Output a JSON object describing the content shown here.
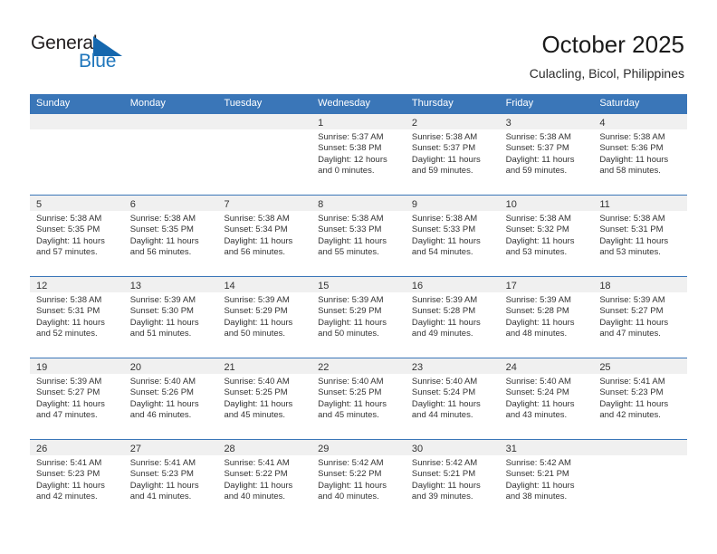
{
  "logo": {
    "word1": "General",
    "word2": "Blue",
    "triangle_color": "#1567ae",
    "blue_text_color": "#1f76bc"
  },
  "header": {
    "title": "October 2025",
    "subtitle": "Culacling, Bicol, Philippines"
  },
  "calendar": {
    "header_bg": "#3a76b8",
    "day_band_bg": "#f0f0f0",
    "weekdays": [
      "Sunday",
      "Monday",
      "Tuesday",
      "Wednesday",
      "Thursday",
      "Friday",
      "Saturday"
    ],
    "weeks": [
      [
        {
          "day": "",
          "sunrise": "",
          "sunset": "",
          "daylight1": "",
          "daylight2": ""
        },
        {
          "day": "",
          "sunrise": "",
          "sunset": "",
          "daylight1": "",
          "daylight2": ""
        },
        {
          "day": "",
          "sunrise": "",
          "sunset": "",
          "daylight1": "",
          "daylight2": ""
        },
        {
          "day": "1",
          "sunrise": "Sunrise: 5:37 AM",
          "sunset": "Sunset: 5:38 PM",
          "daylight1": "Daylight: 12 hours",
          "daylight2": "and 0 minutes."
        },
        {
          "day": "2",
          "sunrise": "Sunrise: 5:38 AM",
          "sunset": "Sunset: 5:37 PM",
          "daylight1": "Daylight: 11 hours",
          "daylight2": "and 59 minutes."
        },
        {
          "day": "3",
          "sunrise": "Sunrise: 5:38 AM",
          "sunset": "Sunset: 5:37 PM",
          "daylight1": "Daylight: 11 hours",
          "daylight2": "and 59 minutes."
        },
        {
          "day": "4",
          "sunrise": "Sunrise: 5:38 AM",
          "sunset": "Sunset: 5:36 PM",
          "daylight1": "Daylight: 11 hours",
          "daylight2": "and 58 minutes."
        }
      ],
      [
        {
          "day": "5",
          "sunrise": "Sunrise: 5:38 AM",
          "sunset": "Sunset: 5:35 PM",
          "daylight1": "Daylight: 11 hours",
          "daylight2": "and 57 minutes."
        },
        {
          "day": "6",
          "sunrise": "Sunrise: 5:38 AM",
          "sunset": "Sunset: 5:35 PM",
          "daylight1": "Daylight: 11 hours",
          "daylight2": "and 56 minutes."
        },
        {
          "day": "7",
          "sunrise": "Sunrise: 5:38 AM",
          "sunset": "Sunset: 5:34 PM",
          "daylight1": "Daylight: 11 hours",
          "daylight2": "and 56 minutes."
        },
        {
          "day": "8",
          "sunrise": "Sunrise: 5:38 AM",
          "sunset": "Sunset: 5:33 PM",
          "daylight1": "Daylight: 11 hours",
          "daylight2": "and 55 minutes."
        },
        {
          "day": "9",
          "sunrise": "Sunrise: 5:38 AM",
          "sunset": "Sunset: 5:33 PM",
          "daylight1": "Daylight: 11 hours",
          "daylight2": "and 54 minutes."
        },
        {
          "day": "10",
          "sunrise": "Sunrise: 5:38 AM",
          "sunset": "Sunset: 5:32 PM",
          "daylight1": "Daylight: 11 hours",
          "daylight2": "and 53 minutes."
        },
        {
          "day": "11",
          "sunrise": "Sunrise: 5:38 AM",
          "sunset": "Sunset: 5:31 PM",
          "daylight1": "Daylight: 11 hours",
          "daylight2": "and 53 minutes."
        }
      ],
      [
        {
          "day": "12",
          "sunrise": "Sunrise: 5:38 AM",
          "sunset": "Sunset: 5:31 PM",
          "daylight1": "Daylight: 11 hours",
          "daylight2": "and 52 minutes."
        },
        {
          "day": "13",
          "sunrise": "Sunrise: 5:39 AM",
          "sunset": "Sunset: 5:30 PM",
          "daylight1": "Daylight: 11 hours",
          "daylight2": "and 51 minutes."
        },
        {
          "day": "14",
          "sunrise": "Sunrise: 5:39 AM",
          "sunset": "Sunset: 5:29 PM",
          "daylight1": "Daylight: 11 hours",
          "daylight2": "and 50 minutes."
        },
        {
          "day": "15",
          "sunrise": "Sunrise: 5:39 AM",
          "sunset": "Sunset: 5:29 PM",
          "daylight1": "Daylight: 11 hours",
          "daylight2": "and 50 minutes."
        },
        {
          "day": "16",
          "sunrise": "Sunrise: 5:39 AM",
          "sunset": "Sunset: 5:28 PM",
          "daylight1": "Daylight: 11 hours",
          "daylight2": "and 49 minutes."
        },
        {
          "day": "17",
          "sunrise": "Sunrise: 5:39 AM",
          "sunset": "Sunset: 5:28 PM",
          "daylight1": "Daylight: 11 hours",
          "daylight2": "and 48 minutes."
        },
        {
          "day": "18",
          "sunrise": "Sunrise: 5:39 AM",
          "sunset": "Sunset: 5:27 PM",
          "daylight1": "Daylight: 11 hours",
          "daylight2": "and 47 minutes."
        }
      ],
      [
        {
          "day": "19",
          "sunrise": "Sunrise: 5:39 AM",
          "sunset": "Sunset: 5:27 PM",
          "daylight1": "Daylight: 11 hours",
          "daylight2": "and 47 minutes."
        },
        {
          "day": "20",
          "sunrise": "Sunrise: 5:40 AM",
          "sunset": "Sunset: 5:26 PM",
          "daylight1": "Daylight: 11 hours",
          "daylight2": "and 46 minutes."
        },
        {
          "day": "21",
          "sunrise": "Sunrise: 5:40 AM",
          "sunset": "Sunset: 5:25 PM",
          "daylight1": "Daylight: 11 hours",
          "daylight2": "and 45 minutes."
        },
        {
          "day": "22",
          "sunrise": "Sunrise: 5:40 AM",
          "sunset": "Sunset: 5:25 PM",
          "daylight1": "Daylight: 11 hours",
          "daylight2": "and 45 minutes."
        },
        {
          "day": "23",
          "sunrise": "Sunrise: 5:40 AM",
          "sunset": "Sunset: 5:24 PM",
          "daylight1": "Daylight: 11 hours",
          "daylight2": "and 44 minutes."
        },
        {
          "day": "24",
          "sunrise": "Sunrise: 5:40 AM",
          "sunset": "Sunset: 5:24 PM",
          "daylight1": "Daylight: 11 hours",
          "daylight2": "and 43 minutes."
        },
        {
          "day": "25",
          "sunrise": "Sunrise: 5:41 AM",
          "sunset": "Sunset: 5:23 PM",
          "daylight1": "Daylight: 11 hours",
          "daylight2": "and 42 minutes."
        }
      ],
      [
        {
          "day": "26",
          "sunrise": "Sunrise: 5:41 AM",
          "sunset": "Sunset: 5:23 PM",
          "daylight1": "Daylight: 11 hours",
          "daylight2": "and 42 minutes."
        },
        {
          "day": "27",
          "sunrise": "Sunrise: 5:41 AM",
          "sunset": "Sunset: 5:23 PM",
          "daylight1": "Daylight: 11 hours",
          "daylight2": "and 41 minutes."
        },
        {
          "day": "28",
          "sunrise": "Sunrise: 5:41 AM",
          "sunset": "Sunset: 5:22 PM",
          "daylight1": "Daylight: 11 hours",
          "daylight2": "and 40 minutes."
        },
        {
          "day": "29",
          "sunrise": "Sunrise: 5:42 AM",
          "sunset": "Sunset: 5:22 PM",
          "daylight1": "Daylight: 11 hours",
          "daylight2": "and 40 minutes."
        },
        {
          "day": "30",
          "sunrise": "Sunrise: 5:42 AM",
          "sunset": "Sunset: 5:21 PM",
          "daylight1": "Daylight: 11 hours",
          "daylight2": "and 39 minutes."
        },
        {
          "day": "31",
          "sunrise": "Sunrise: 5:42 AM",
          "sunset": "Sunset: 5:21 PM",
          "daylight1": "Daylight: 11 hours",
          "daylight2": "and 38 minutes."
        },
        {
          "day": "",
          "sunrise": "",
          "sunset": "",
          "daylight1": "",
          "daylight2": ""
        }
      ]
    ]
  }
}
